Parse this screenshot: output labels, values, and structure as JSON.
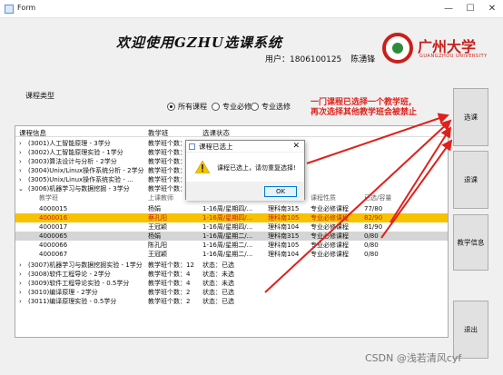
{
  "window": {
    "title": "Form",
    "minimize": "—",
    "maximize": "☐",
    "close": "✕"
  },
  "header": {
    "headline": "欢迎使用GZHU选课系统",
    "user_label": "用户：",
    "user_id": "1806100125",
    "user_name": "陈湧锋",
    "logo_text": "广州大学",
    "logo_sub": "GUANGZHOU UNIVERSITY"
  },
  "filter": {
    "group_label": "课程类型",
    "options": [
      "所有课程",
      "专业必修",
      "专业选修"
    ],
    "selected": "所有课程"
  },
  "annotation": {
    "line1": "一门课程已选择一个教学班,",
    "line2": "再次选择其他教学班会被禁止"
  },
  "tree": {
    "headers": [
      "课程信息",
      "教学班",
      "选课状态"
    ],
    "courses_top": [
      {
        "name": "(3001)人工智能原理 - 3学分",
        "classes": "教学班个数：",
        "status": ""
      },
      {
        "name": "(3002)人工智能原理实验 - 1学分",
        "classes": "教学班个数：",
        "status": ""
      },
      {
        "name": "(3003)算法设计与分析 - 2学分",
        "classes": "教学班个数：",
        "status": ""
      },
      {
        "name": "(3004)Unix/Linux操作系统分析 - 2学分",
        "classes": "教学班个数：",
        "status": ""
      },
      {
        "name": "(3005)Unix/Linux操作系统实验 - ...",
        "classes": "教学班个数：",
        "status": ""
      },
      {
        "name": "(3006)机器学习与数据挖掘 - 3学分",
        "classes": "教学班个数：",
        "status": ""
      }
    ],
    "sub_headers": [
      "教学班",
      "上课教师",
      "上课时间",
      "课程性质",
      "已选/容量"
    ],
    "sub_rows": [
      {
        "id": "4000015",
        "teacher": "杨娟",
        "time": "1-16周/星期四/...",
        "room": "理科南315",
        "type": "专业必修课程",
        "count": "77/80"
      },
      {
        "id": "4000016",
        "teacher": "蔡孔阳",
        "time": "1-16周/星期四/...",
        "room": "理科南105",
        "type": "专业必修课程",
        "count": "82/90"
      },
      {
        "id": "4000017",
        "teacher": "王冠颖",
        "time": "1-16周/星期四/...",
        "room": "理科南104",
        "type": "专业必修课程",
        "count": "81/90"
      },
      {
        "id": "4000065",
        "teacher": "杨娟",
        "time": "1-16周/星期二/...",
        "room": "理科南315",
        "type": "专业必修课程",
        "count": "0/80"
      },
      {
        "id": "4000066",
        "teacher": "陈孔阳",
        "time": "1-16周/星期二/...",
        "room": "理科南105",
        "type": "专业必修课程",
        "count": "0/80"
      },
      {
        "id": "4000067",
        "teacher": "王冠颖",
        "time": "1-16周/星期二/...",
        "room": "理科南104",
        "type": "专业必修课程",
        "count": "0/80"
      }
    ],
    "courses_bottom": [
      {
        "name": "(3007)机器学习与数据挖掘实验 - 1学分",
        "classes": "教学班个数：12",
        "status": "状态：已选"
      },
      {
        "name": "(3008)软件工程导论 - 2学分",
        "classes": "教学班个数：4",
        "status": "状态：未选"
      },
      {
        "name": "(3009)软件工程导论实验 - 0.5学分",
        "classes": "教学班个数：4",
        "status": "状态：未选"
      },
      {
        "name": "(3010)编译原理 - 2学分",
        "classes": "教学班个数：2",
        "status": "状态：已选"
      },
      {
        "name": "(3011)编译原理实验 - 0.5学分",
        "classes": "教学班个数：2",
        "status": "状态：已选"
      }
    ]
  },
  "dialog": {
    "title": "课程已选上",
    "message": "课程已选上，请勿重复选择!",
    "ok": "OK"
  },
  "buttons": {
    "select": "选课",
    "drop": "退课",
    "info": "教学信息",
    "exit": "退出"
  },
  "watermark": "CSDN @浅若清风cyf",
  "colors": {
    "annotation": "#e0201b",
    "selected_row": "#f7c300",
    "selected_row_text": "#c81b1b",
    "brand": "#c8201b"
  }
}
